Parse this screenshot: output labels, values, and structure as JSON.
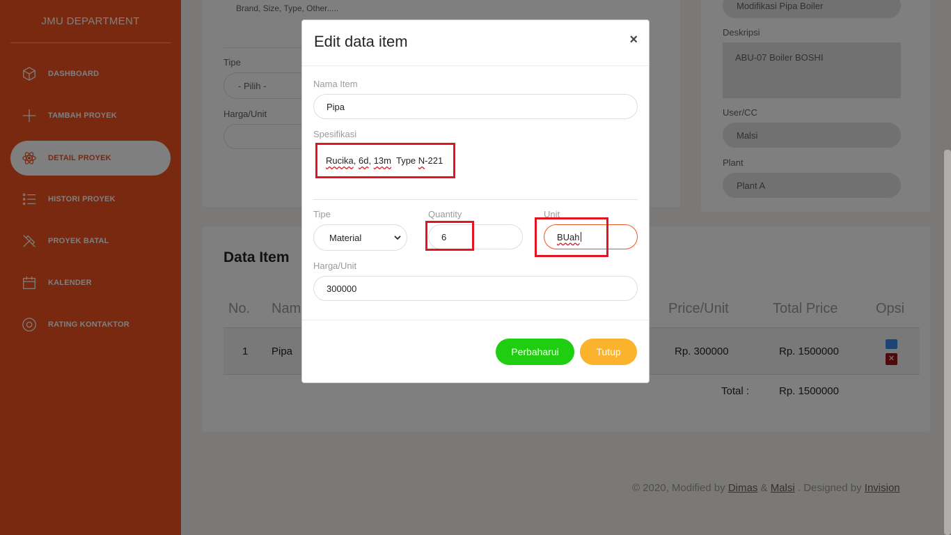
{
  "sidebar": {
    "brand": "JMU DEPARTMENT",
    "items": [
      {
        "label": "DASHBOARD",
        "icon": "box-icon"
      },
      {
        "label": "TAMBAH PROYEK",
        "icon": "plus-icon"
      },
      {
        "label": "DETAIL PROYEK",
        "icon": "atom-icon",
        "active": true
      },
      {
        "label": "HISTORI PROYEK",
        "icon": "list-icon"
      },
      {
        "label": "PROYEK BATAL",
        "icon": "tools-icon"
      },
      {
        "label": "KALENDER",
        "icon": "calendar-icon"
      },
      {
        "label": "RATING KONTAKTOR",
        "icon": "user-circle-icon"
      }
    ]
  },
  "form_card": {
    "spec_placeholder": "Brand, Size, Type, Other.....",
    "tipe_label": "Tipe",
    "tipe_value": "- Pilih -",
    "harga_label": "Harga/Unit"
  },
  "project_card": {
    "nama_value": "Modifikasi Pipa Boiler",
    "deskripsi_label": "Deskripsi",
    "deskripsi_value": "ABU-07 Boiler BOSHI",
    "user_label": "User/CC",
    "user_value": "Malsi",
    "plant_label": "Plant",
    "plant_value": "Plant A"
  },
  "table_card": {
    "title": "Data Item",
    "headers": {
      "no": "No.",
      "name": "Nama",
      "price": "Price/Unit",
      "total": "Total Price",
      "opsi": "Opsi"
    },
    "row": {
      "no": "1",
      "name": "Pipa",
      "price": "Rp. 300000",
      "total": "Rp. 1500000"
    },
    "total_label": "Total :",
    "total_value": "Rp. 1500000"
  },
  "footer": {
    "prefix": "© 2020, Modified by",
    "author1": "Dimas",
    "amp": "&",
    "author2": "Malsi",
    "mid": ". Designed by",
    "designer": "Invision"
  },
  "modal": {
    "title": "Edit data item",
    "close": "×",
    "nama_label": "Nama Item",
    "nama_value": "Pipa",
    "spec_label": "Spesifikasi",
    "spec_value_parts": [
      "Rucika",
      ", ",
      "6d",
      ", ",
      "13m",
      "  Type ",
      "N",
      "-221"
    ],
    "tipe_label": "Tipe",
    "tipe_value": "Material",
    "qty_label": "Quantity",
    "qty_value": "6",
    "unit_label": "Unit",
    "unit_value": "BUah",
    "harga_label": "Harga/Unit",
    "harga_value": "300000",
    "update_button": "Perbaharui",
    "close_button": "Tutup"
  },
  "colors": {
    "sidebar": "#f0531f",
    "update_button": "#1fcd11",
    "close_button": "#fbb32e",
    "highlight": "#e2141f"
  }
}
